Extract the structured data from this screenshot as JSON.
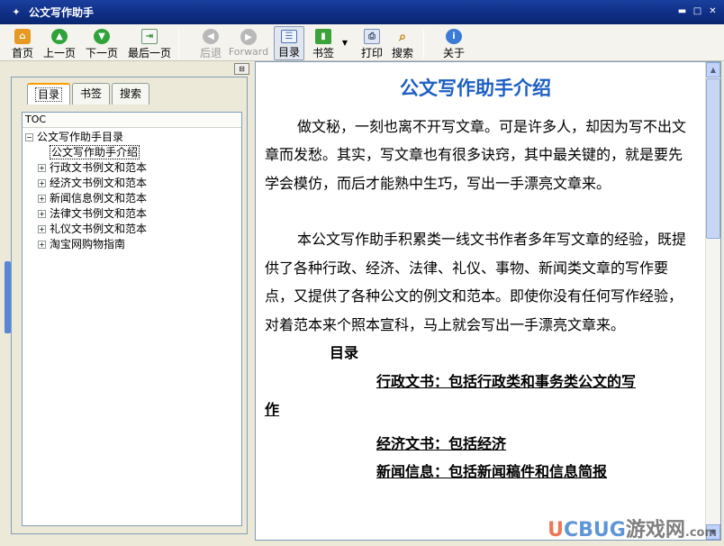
{
  "window": {
    "title": "公文写作助手"
  },
  "toolbar": {
    "home": "首页",
    "prev": "上一页",
    "next": "下一页",
    "last": "最后一页",
    "back": "后退",
    "forward": "Forward",
    "toc": "目录",
    "bookmark": "书签",
    "print": "打印",
    "search": "搜索",
    "about": "关于"
  },
  "tabs": [
    "目录",
    "书签",
    "搜索"
  ],
  "tree": {
    "header": "TOC",
    "root": "公文写作助手目录",
    "items": [
      "公文写作助手介绍",
      "行政文书例文和范本",
      "经济文书例文和范本",
      "新闻信息例文和范本",
      "法律文书例文和范本",
      "礼仪文书例文和范本",
      "淘宝网购物指南"
    ]
  },
  "doc": {
    "title": "公文写作助手介绍",
    "para1": "做文秘，一刻也离不开写文章。可是许多人，却因为写不出文章而发愁。其实，写文章也有很多诀窍，其中最关键的，就是要先学会模仿，而后才能熟中生巧，写出一手漂亮文章来。",
    "para2": "本公文写作助手积累类一线文书作者多年写文章的经验，既提供了各种行政、经济、法律、礼仪、事物、新闻类文章的写作要点，又提供了各种公文的例文和范本。即使你没有任何写作经验，对着范本来个照本宣科，马上就会写出一手漂亮文章来。",
    "toc_heading": "目录",
    "toc_item1a": "行政文书：包括行政类和事务类公文的写",
    "toc_item1b": "作",
    "toc_item2": "经济文书：包括经济",
    "toc_item3": "新闻信息：包括新闻稿件和信息简报"
  },
  "watermark": {
    "a": "U",
    "b": "CBUG",
    "c": "游戏网",
    "d": ".com"
  }
}
